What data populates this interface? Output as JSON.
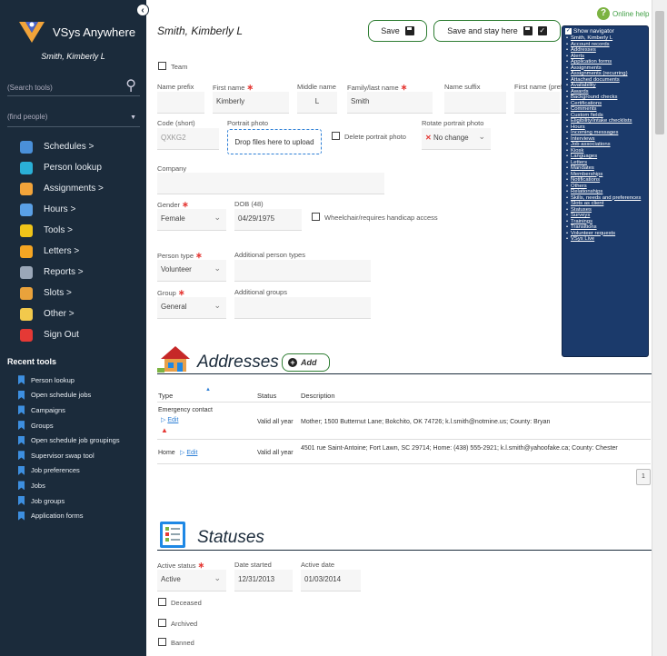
{
  "sidebar": {
    "app_title": "VSys Anywhere",
    "user_name": "Smith, Kimberly L",
    "search_placeholder": "(Search tools)",
    "people_placeholder": "(find people)",
    "nav": [
      {
        "label": "Schedules >",
        "icon": "calendar-icon",
        "color": "#4a90d9"
      },
      {
        "label": "Person lookup",
        "icon": "person-search-icon",
        "color": "#2ab0d8"
      },
      {
        "label": "Assignments >",
        "icon": "assignments-icon",
        "color": "#f2a43a"
      },
      {
        "label": "Hours >",
        "icon": "clock-icon",
        "color": "#5aa0e6"
      },
      {
        "label": "Tools >",
        "icon": "tools-icon",
        "color": "#f0c419"
      },
      {
        "label": "Letters >",
        "icon": "letter-icon",
        "color": "#f5a623"
      },
      {
        "label": "Reports >",
        "icon": "printer-icon",
        "color": "#9aa7b8"
      },
      {
        "label": "Slots >",
        "icon": "grid-icon",
        "color": "#e9a23b"
      },
      {
        "label": "Other >",
        "icon": "other-icon",
        "color": "#f2c94c"
      },
      {
        "label": "Sign Out",
        "icon": "sign-out-icon",
        "color": "#e53935"
      }
    ],
    "recent_title": "Recent tools",
    "recent": [
      "Person lookup",
      "Open schedule jobs",
      "Campaigns",
      "Groups",
      "Open schedule job groupings",
      "Supervisor swap tool",
      "Job preferences",
      "Jobs",
      "Job groups",
      "Application forms"
    ]
  },
  "header": {
    "title": "Smith, Kimberly L",
    "save_label": "Save",
    "save_stay_label": "Save and stay here",
    "help_label": "Online help"
  },
  "form": {
    "team_label": "Team",
    "prefix_label": "Name prefix",
    "first_label": "First name",
    "first_value": "Kimberly",
    "middle_label": "Middle name",
    "middle_value": "L",
    "last_label": "Family/last name",
    "last_value": "Smith",
    "suffix_label": "Name suffix",
    "pref_label": "First name (prefer",
    "code_label": "Code (short)",
    "code_value": "QXKG2",
    "portrait_label": "Portrait photo",
    "drop_text": "Drop files here to upload",
    "delete_portrait": "Delete portrait photo",
    "rotate_label": "Rotate portrait photo",
    "rotate_value": "No change",
    "company_label": "Company",
    "gender_label": "Gender",
    "gender_value": "Female",
    "dob_label": "DOB (48)",
    "dob_value": "04/29/1975",
    "wheelchair_label": "Wheelchair/requires handicap access",
    "person_type_label": "Person type",
    "person_type_value": "Volunteer",
    "add_types_label": "Additional person types",
    "group_label": "Group",
    "group_value": "General",
    "add_groups_label": "Additional groups"
  },
  "addresses": {
    "title": "Addresses",
    "add_label": "Add",
    "columns": [
      "Type",
      "Status",
      "Description"
    ],
    "rows": [
      {
        "type": "Emergency contact",
        "edit": "Edit",
        "status": "Valid all year",
        "desc": "Mother; 1500 Butternut Lane; Bokchito, OK 74726; k.l.smith@notmine.us; County: Bryan"
      },
      {
        "type": "Home",
        "edit": "Edit",
        "status": "Valid all year",
        "desc": "4501 rue Saint-Antoine; Fort Lawn, SC 29714; Home: (438) 555-2921; k.l.smith@yahoofake.ca; County: Chester"
      }
    ],
    "page": "1"
  },
  "statuses": {
    "title": "Statuses",
    "active_label": "Active status",
    "active_value": "Active",
    "started_label": "Date started",
    "started_value": "12/31/2013",
    "active_date_label": "Active date",
    "active_date_value": "01/03/2014",
    "deceased": "Deceased",
    "archived": "Archived",
    "banned": "Banned"
  },
  "navigator": {
    "show_label": "Show navigator",
    "items": [
      "Smith, Kimberly L",
      "Account records",
      "Addresses",
      "Alerts",
      "Application forms",
      "Assignments",
      "Assignments (recurring)",
      "Attached documents",
      "Availability",
      "Awards",
      "Background checks",
      "Certifications",
      "Comments",
      "Custom fields",
      "Eligibility/intake checklists",
      "Hours",
      "Incoming messages",
      "Interviews",
      "Job associations",
      "Kiosk",
      "Languages",
      "Letters",
      "Mandates",
      "Memberships",
      "Notifications",
      "Others",
      "Relationships",
      "Skills, needs and preferences",
      "Slots as client",
      "Statuses",
      "Surveys",
      "Trainings",
      "Transitions",
      "Volunteer requests",
      "VSys Live"
    ]
  },
  "colors": {
    "sidebar": "#1b2b3b",
    "accent": "#2e7d32",
    "navigator": "#1b3a6b",
    "required": "#e53935"
  }
}
